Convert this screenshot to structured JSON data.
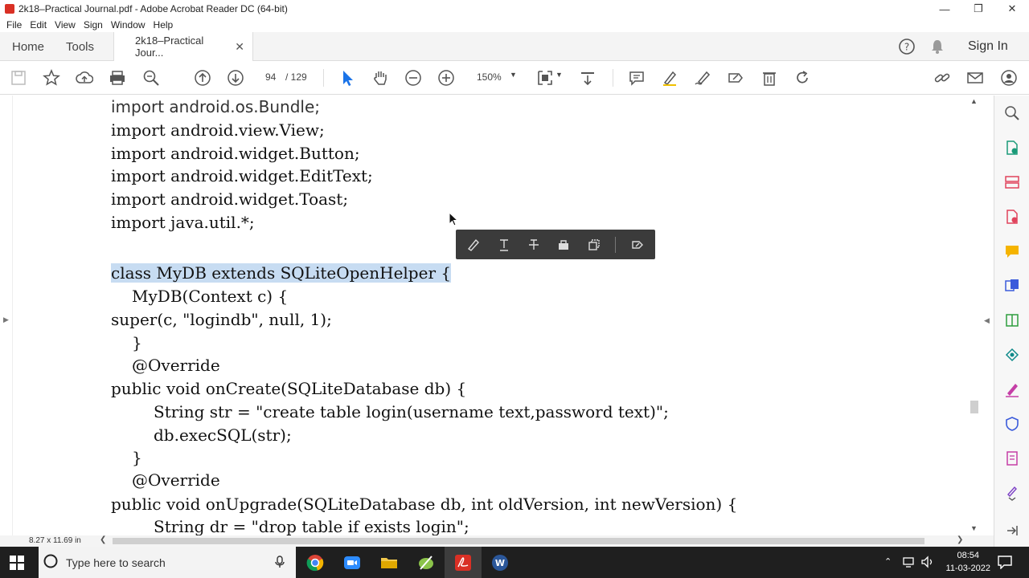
{
  "window": {
    "title": "2k18–Practical Journal.pdf - Adobe Acrobat Reader DC (64-bit)"
  },
  "menu": [
    "File",
    "Edit",
    "View",
    "Sign",
    "Window",
    "Help"
  ],
  "tabs": {
    "home": "Home",
    "tools": "Tools",
    "document": "2k18–Practical Jour...",
    "sign_in": "Sign In"
  },
  "toolbar": {
    "page_current": "94",
    "page_total": "/  129",
    "zoom": "150%"
  },
  "document": {
    "lines": [
      "import android.os.Bundle;",
      "import android.view.View;",
      "import android.widget.Button;",
      "import android.widget.EditText;",
      "import android.widget.Toast;",
      "import java.util.*;",
      "class MyDB extends SQLiteOpenHelper {",
      "MyDB(Context c) {",
      "super(c, \"logindb\", null, 1);",
      "}",
      "@Override",
      "public void onCreate(SQLiteDatabase db) {",
      "String str = \"create table login(username text,password text)\";",
      "db.execSQL(str);",
      "}",
      "@Override",
      "public void onUpgrade(SQLiteDatabase db, int oldVersion, int newVersion) {",
      "String dr = \"drop table if exists login\";"
    ]
  },
  "status": {
    "page_size": "8.27 x 11.69 in"
  },
  "taskbar": {
    "search_placeholder": "Type here to search",
    "time": "08:54",
    "date": "11-03-2022"
  },
  "colors": {
    "selection": "#c7dcf2",
    "accent_blue": "#1a73e8",
    "pdf_red": "#d93025"
  }
}
